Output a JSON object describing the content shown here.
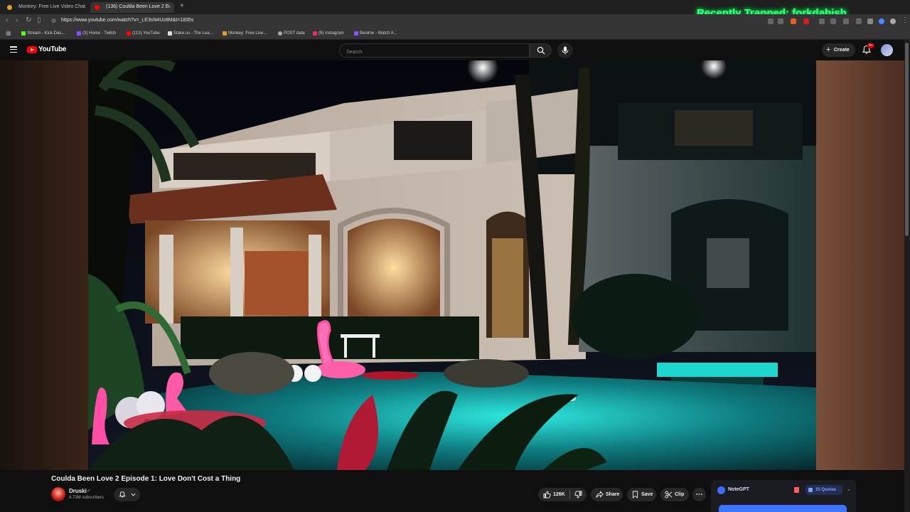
{
  "browser": {
    "tabs": [
      {
        "title": "Monkey: Free Live Video Chat",
        "active": false,
        "favicon_color": "#e0a020"
      },
      {
        "title": "(136) Coulda Been Love 2 E",
        "active": true,
        "favicon_color": "#ff0000"
      }
    ],
    "new_tab": "+",
    "url": "https://www.youtube.com/watch?v=_LE3sN4Uc8M&t=1835s",
    "overlay_text": "Recently Trapped: forkdabish",
    "bookmarks": [
      {
        "label": "Stream - Kick Das...",
        "color": "#53fc18"
      },
      {
        "label": "(3) Home - Twitch",
        "color": "#9146ff"
      },
      {
        "label": "(113) YouTube",
        "color": "#ff0000"
      },
      {
        "label": "Stake.us - The Lea...",
        "color": "#dddddd"
      },
      {
        "label": "Monkey: Free Live...",
        "color": "#e0a020"
      },
      {
        "label": "POST data",
        "color": "#aaaaaa"
      },
      {
        "label": "(9) Instagram",
        "color": "#e1306c"
      },
      {
        "label": "Benime - Watch A...",
        "color": "#8a4fff"
      }
    ]
  },
  "youtube": {
    "logo_text": "YouTube",
    "search_placeholder": "Search",
    "create_label": "Create",
    "notifications_badge": "9+"
  },
  "video": {
    "title": "Coulda Been Love 2 Episode 1: Love Don't Cost a Thing",
    "channel_name": "Druski",
    "verified_mark": "✓",
    "subscribers": "4.73M subscribers",
    "likes": "126K",
    "share_label": "Share",
    "save_label": "Save",
    "clip_label": "Clip",
    "more_label": "⋯"
  },
  "notegpt": {
    "name": "NoteGPT",
    "quota_label": "15 Quotas",
    "chevron": "⌄"
  },
  "colors": {
    "brand_red": "#ff0000",
    "overlay_green": "#3dff7a",
    "pool_teal": "#1fd6cf",
    "notegpt_blue": "#3d74ff"
  }
}
